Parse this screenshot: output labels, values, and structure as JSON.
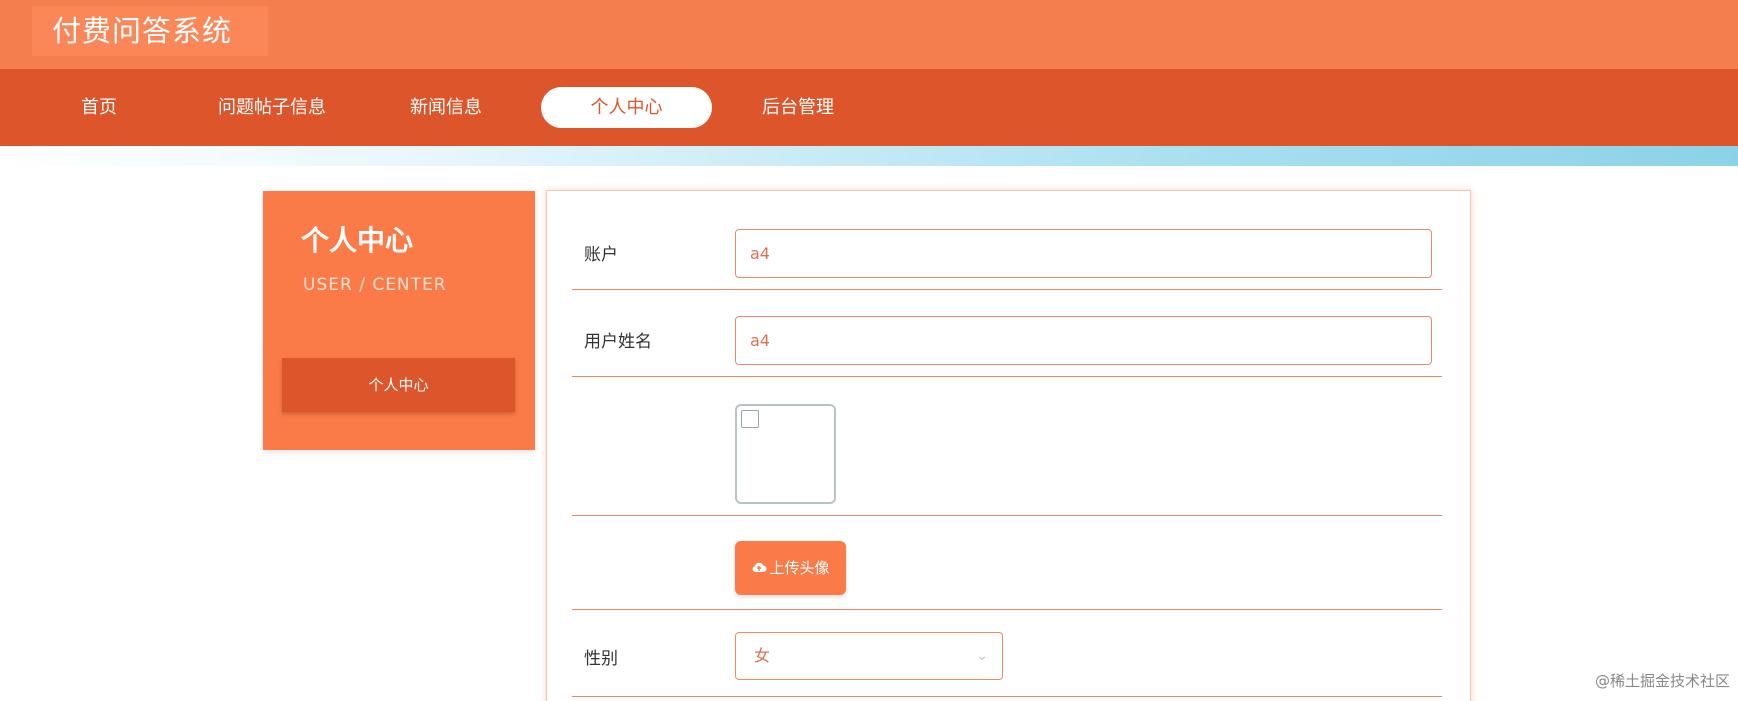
{
  "app": {
    "title": "付费问答系统"
  },
  "nav": {
    "items": [
      {
        "label": "首页"
      },
      {
        "label": "问题帖子信息"
      },
      {
        "label": "新闻信息"
      },
      {
        "label": "个人中心",
        "active": true
      },
      {
        "label": "后台管理"
      }
    ]
  },
  "sidebar": {
    "title": "个人中心",
    "subtitle": "USER / CENTER",
    "menu": [
      {
        "label": "个人中心"
      }
    ]
  },
  "form": {
    "account": {
      "label": "账户",
      "value": "a4"
    },
    "username": {
      "label": "用户姓名",
      "value": "a4"
    },
    "avatar": {
      "upload_label": "上传头像",
      "icon": "cloud-upload-icon"
    },
    "gender": {
      "label": "性别",
      "value": "女",
      "icon": "chevron-down-icon"
    }
  },
  "watermark": "@稀土掘金技术社区",
  "colors": {
    "header": "#f57e4e",
    "nav": "#dd552b",
    "accent": "#fa7a48",
    "field_text": "#e0704c"
  }
}
